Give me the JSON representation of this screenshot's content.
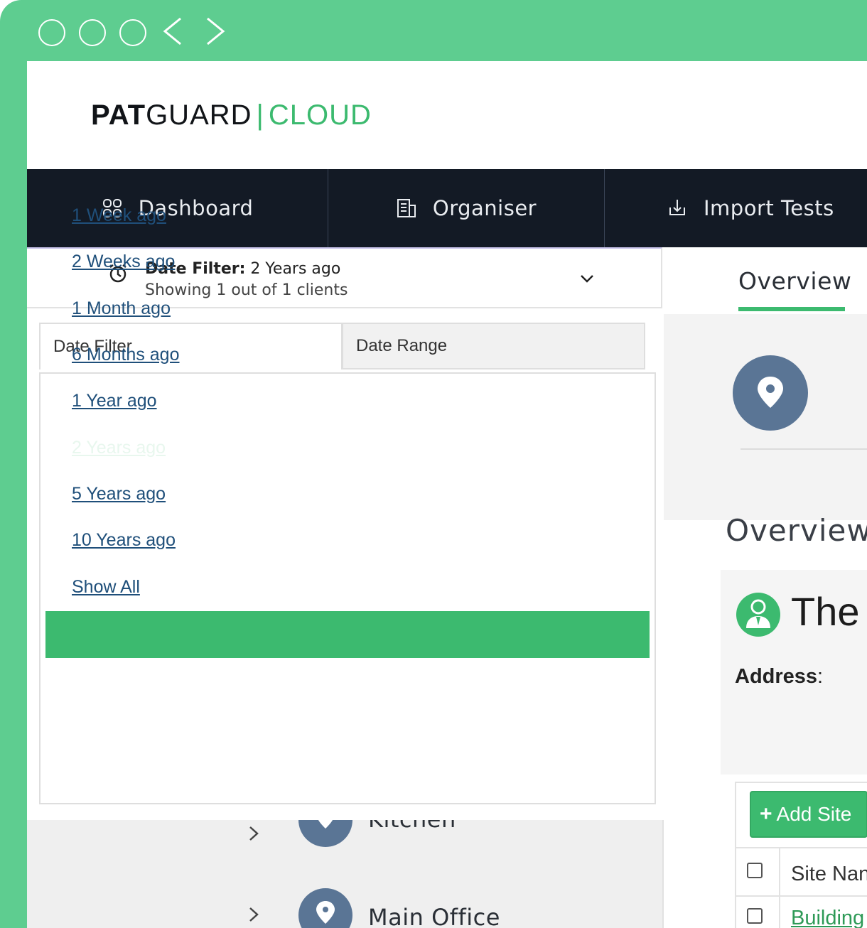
{
  "logo": {
    "pat": "PAT",
    "guard": "GUARD",
    "separator": "|",
    "cloud": "CLOUD"
  },
  "nav": {
    "items": [
      {
        "label": "Dashboard",
        "icon": "grid-icon"
      },
      {
        "label": "Organiser",
        "icon": "building-icon"
      },
      {
        "label": "Import Tests",
        "icon": "download-icon"
      }
    ]
  },
  "filter": {
    "label": "Date Filter:",
    "value": "2 Years ago",
    "summary": "Showing 1 out of 1 clients"
  },
  "dropdown": {
    "tabs": [
      {
        "label": "Date Filter",
        "active": true
      },
      {
        "label": "Date Range",
        "active": false
      }
    ],
    "options": [
      "1 Week ago",
      "2 Weeks ago",
      "1 Month ago",
      "6 Months ago",
      "1 Year ago",
      "2 Years ago",
      "5 Years ago",
      "10 Years ago",
      "Show All"
    ],
    "selected": "2 Years ago"
  },
  "tree": {
    "items": [
      {
        "label": "Kitchen"
      },
      {
        "label": "Main Office"
      }
    ]
  },
  "overview": {
    "tab_label": "Overview",
    "heading": "Overview",
    "client_name": "The",
    "address_label": "Address",
    "address_colon": ":"
  },
  "sites": {
    "add_button": "Add Site",
    "column_site_name": "Site Nan",
    "first_row": "Building"
  },
  "colors": {
    "accent": "#3cba6f",
    "frame": "#5ecd90",
    "navbar": "#131a25",
    "pin": "#5a7595",
    "link": "#1f4f7a"
  }
}
